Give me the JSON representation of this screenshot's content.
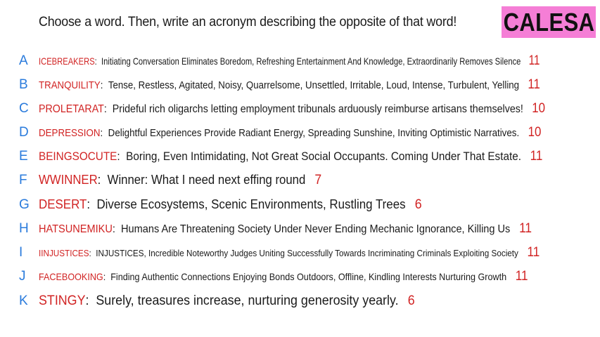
{
  "prompt": "Choose a word. Then, write an acronym describing the opposite of that word!",
  "logo_text": "CALESA",
  "colors": {
    "logo_bg": "#f57ed6",
    "letter": "#2a7bdc",
    "word": "#d12323",
    "count": "#d12323"
  },
  "entries": [
    {
      "letter": "A",
      "word": "ICEBREAKERS",
      "acronym": "Initiating Conversation Eliminates Boredom, Refreshing Entertainment And Knowledge, Extraordinarily Removes Silence",
      "count": "11"
    },
    {
      "letter": "B",
      "word": "TRANQUILITY",
      "acronym": "Tense, Restless, Agitated, Noisy, Quarrelsome, Unsettled, Irritable, Loud, Intense, Turbulent, Yelling",
      "count": "11"
    },
    {
      "letter": "C",
      "word": "PROLETARAT",
      "acronym": "Prideful rich oligarchs letting employment tribunals arduously reimburse artisans themselves!",
      "count": "10"
    },
    {
      "letter": "D",
      "word": "DEPRESSION",
      "acronym": "Delightful Experiences Provide Radiant Energy, Spreading Sunshine, Inviting Optimistic Narratives.",
      "count": "10"
    },
    {
      "letter": "E",
      "word": "BEINGSOCUTE",
      "acronym": "Boring, Even Intimidating, Not Great Social Occupants. Coming Under That Estate.",
      "count": "11"
    },
    {
      "letter": "F",
      "word": "WWINNER",
      "acronym": "Winner: What I need next effing round",
      "count": "7"
    },
    {
      "letter": "G",
      "word": "DESERT",
      "acronym": "Diverse Ecosystems, Scenic Environments, Rustling Trees",
      "count": "6"
    },
    {
      "letter": "H",
      "word": "HATSUNEMIKU",
      "acronym": "Humans Are Threatening Society Under Never Ending Mechanic Ignorance, Killing Us",
      "count": "11"
    },
    {
      "letter": "I",
      "word": "IINJUSTICES",
      "acronym": "INJUSTICES, Incredible Noteworthy Judges Uniting Successfully Towards Incriminating Criminals Exploiting Society",
      "count": "11"
    },
    {
      "letter": "J",
      "word": "FACEBOOKING",
      "acronym": "Finding Authentic Connections Enjoying Bonds Outdoors, Offline, Kindling Interests Nurturing Growth",
      "count": "11"
    },
    {
      "letter": "K",
      "word": "STINGY",
      "acronym": "Surely, treasures increase, nurturing generosity yearly.",
      "count": "6"
    }
  ]
}
